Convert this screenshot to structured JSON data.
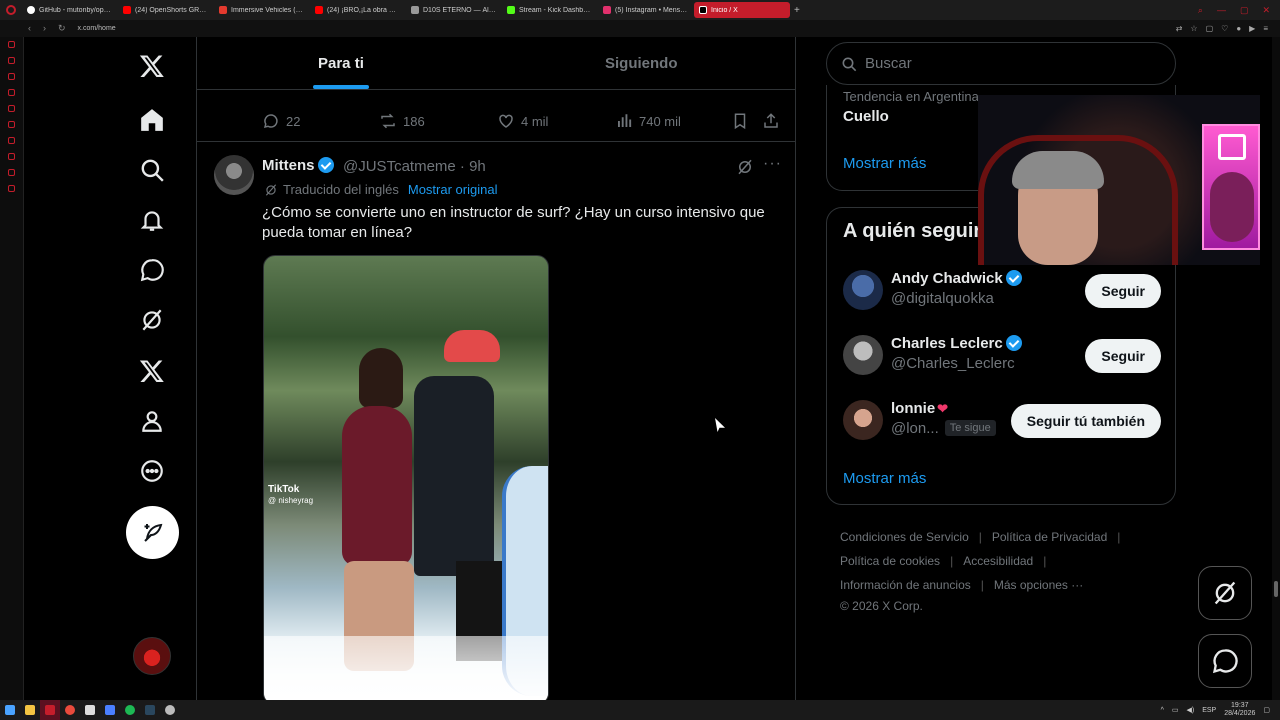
{
  "browser": {
    "tabs": [
      {
        "label": "GitHub - mutonby/opensh",
        "color": "#ffffff"
      },
      {
        "label": "(24) OpenShorts GRATIS",
        "color": "#ff0000"
      },
      {
        "label": "Immersive Vehicles (MTS",
        "color": "#e43a2e"
      },
      {
        "label": "(24) ¡BRO,¡La obra maes",
        "color": "#ff0000"
      },
      {
        "label": "D10S ETERNO — Álbum d",
        "color": "#999999"
      },
      {
        "label": "Stream - Kick Dashboard",
        "color": "#53fc18"
      },
      {
        "label": "(5) Instagram • Mensajes",
        "color": "#e1306c"
      },
      {
        "label": "Inicio / X",
        "color": "#ffffff"
      }
    ],
    "url": "x.com/home"
  },
  "x": {
    "tabs": {
      "for_you": "Para ti",
      "following": "Siguiendo"
    },
    "prev_tweet_actions": {
      "replies": "22",
      "reposts": "186",
      "likes": "4 mil",
      "views": "740 mil"
    },
    "tweet": {
      "name": "Mittens",
      "handle": "@JUSTcatmeme · 9h",
      "translated": "Traducido del inglés",
      "show_original": "Mostrar original",
      "text": "¿Cómo se convierte uno en instructor de surf? ¿Hay un curso intensivo que pueda tomar en línea?",
      "media_watermark": "TikTok",
      "media_watermark_user": "@ nisheyrag"
    },
    "search": {
      "placeholder": "Buscar"
    },
    "trend": {
      "context": "Tendencia en Argentina",
      "name": "Cuello",
      "show_more": "Mostrar más"
    },
    "who_to_follow": {
      "title": "A quién seguir",
      "users": [
        {
          "name": "Andy Chadwick",
          "handle": "@digitalquokka",
          "button": "Seguir"
        },
        {
          "name": "Charles Leclerc",
          "handle": "@Charles_Leclerc",
          "button": "Seguir"
        },
        {
          "name": "lonnie",
          "handle": "@lon...",
          "follows_you": "Te sigue",
          "button": "Seguir tú también"
        }
      ],
      "show_more": "Mostrar más"
    },
    "footer": {
      "links": [
        "Condiciones de Servicio",
        "Política de Privacidad",
        "Política de cookies",
        "Accesibilidad",
        "Información de anuncios",
        "Más opciones ···"
      ],
      "copyright": "© 2026 X Corp."
    }
  },
  "taskbar": {
    "lang": "ESP",
    "time": "19:37",
    "date": "28/4/2026"
  },
  "colors": {
    "accent": "#1d9bf0",
    "browser_accent": "#c41d2b",
    "background": "#000000",
    "border": "#2f3336"
  }
}
